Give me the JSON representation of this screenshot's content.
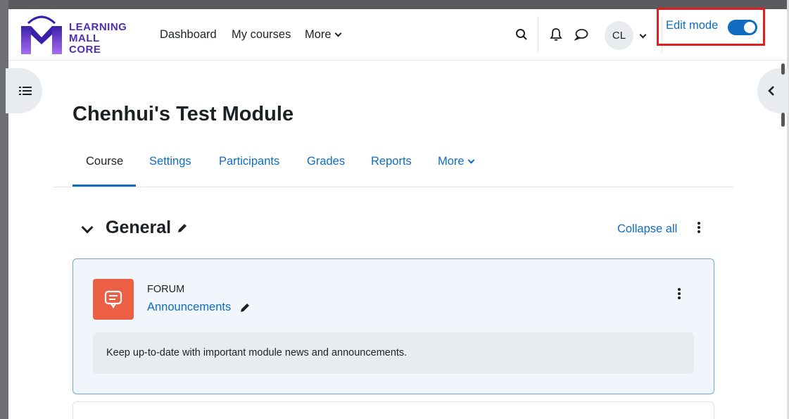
{
  "brand": {
    "line1": "LEARNING",
    "line2": "MALL",
    "line3": "CORE"
  },
  "nav": {
    "dashboard": "Dashboard",
    "my_courses": "My courses",
    "more": "More",
    "avatar_initials": "CL",
    "edit_mode_label": "Edit mode",
    "edit_mode_on": true
  },
  "page": {
    "title": "Chenhui's Test Module"
  },
  "tabs": [
    {
      "label": "Course",
      "active": true
    },
    {
      "label": "Settings"
    },
    {
      "label": "Participants"
    },
    {
      "label": "Grades"
    },
    {
      "label": "Reports"
    },
    {
      "label": "More"
    }
  ],
  "section": {
    "title": "General",
    "collapse_label": "Collapse all"
  },
  "activity": {
    "type": "FORUM",
    "name": "Announcements",
    "description": "Keep up-to-date with important module news and announcements.",
    "icon_color": "#eb5f45"
  },
  "colors": {
    "link": "#0f6cbf",
    "brand": "#4a2fb8",
    "highlight": "#e0201c"
  }
}
